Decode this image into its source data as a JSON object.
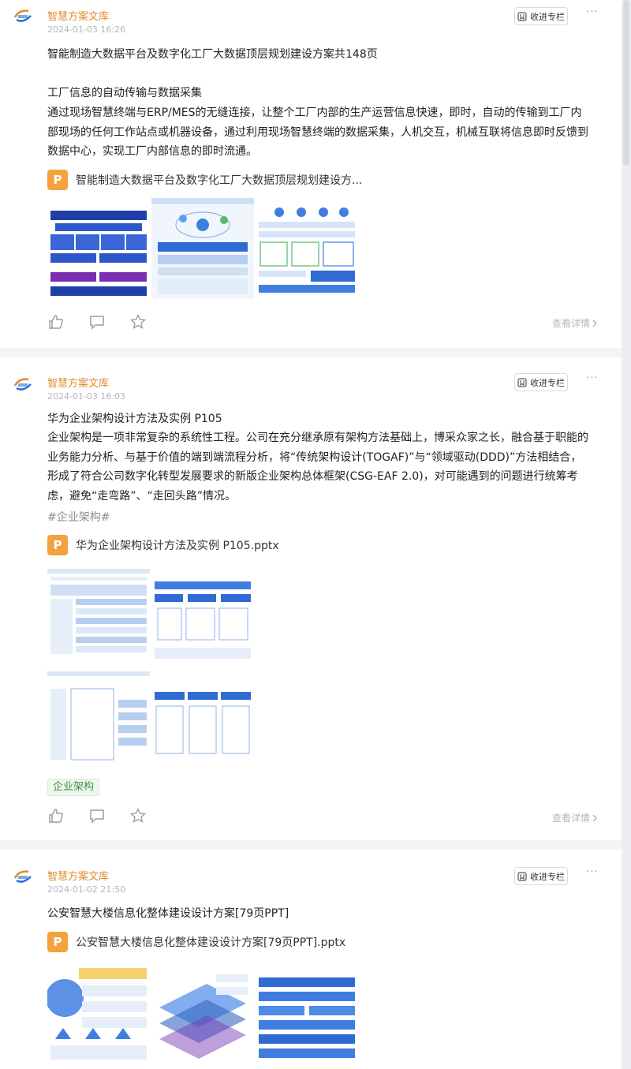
{
  "ui": {
    "collect_label": "收进专栏",
    "more_label": "···",
    "detail_label": "查看详情",
    "file_badge": "P"
  },
  "posts": [
    {
      "author": "智慧方案文库",
      "time": "2024-01-03 16:26",
      "paragraphs": [
        "智能制造大数据平台及数字化工厂大数据顶层规划建设方案共148页",
        "",
        "工厂信息的自动传输与数据采集",
        "通过现场智慧终端与ERP/MES的无缝连接，让整个工厂内部的生产运营信息快速，即时，自动的传输到工厂内部现场的任何工作站点或机器设备，通过利用现场智慧终端的数据采集，人机交互，机械互联将信息即时反馈到数据中心，实现工厂内部信息的即时流通。"
      ],
      "file_name": "智能制造大数据平台及数字化工厂大数据顶层规划建设方..."
    },
    {
      "author": "智慧方案文库",
      "time": "2024-01-03 16:03",
      "paragraphs": [
        "华为企业架构设计方法及实例 P105",
        "企业架构是一项非常复杂的系统性工程。公司在充分继承原有架构方法基础上，博采众家之长，融合基于职能的业务能力分析、与基于价值的端到端流程分析，将“传统架构设计(TOGAF)”与“领域驱动(DDD)”方法相结合，形成了符合公司数字化转型发展要求的新版企业架构总体框架(CSG-EAF 2.0)，对可能遇到的问题进行统筹考虑，避免“走弯路”、“走回头路”情况。"
      ],
      "hashtag": "#企业架构#",
      "file_name": "华为企业架构设计方法及实例 P105.pptx",
      "tag": "企业架构"
    },
    {
      "author": "智慧方案文库",
      "time": "2024-01-02 21:50",
      "paragraphs": [
        "公安智慧大楼信息化整体建设设计方案[79页PPT]"
      ],
      "file_name": "公安智慧大楼信息化整体建设设计方案[79页PPT].pptx"
    }
  ],
  "colors": {
    "author": "#e08a2a",
    "file_icon": "#f4a23e",
    "tag_text": "#3d8f41",
    "meta_gray": "#b3b6bb"
  },
  "icons": [
    "avatar-logo",
    "bookmark-icon",
    "more-icon",
    "file-icon",
    "like-icon",
    "comment-icon",
    "star-icon",
    "chevron-right-icon"
  ]
}
